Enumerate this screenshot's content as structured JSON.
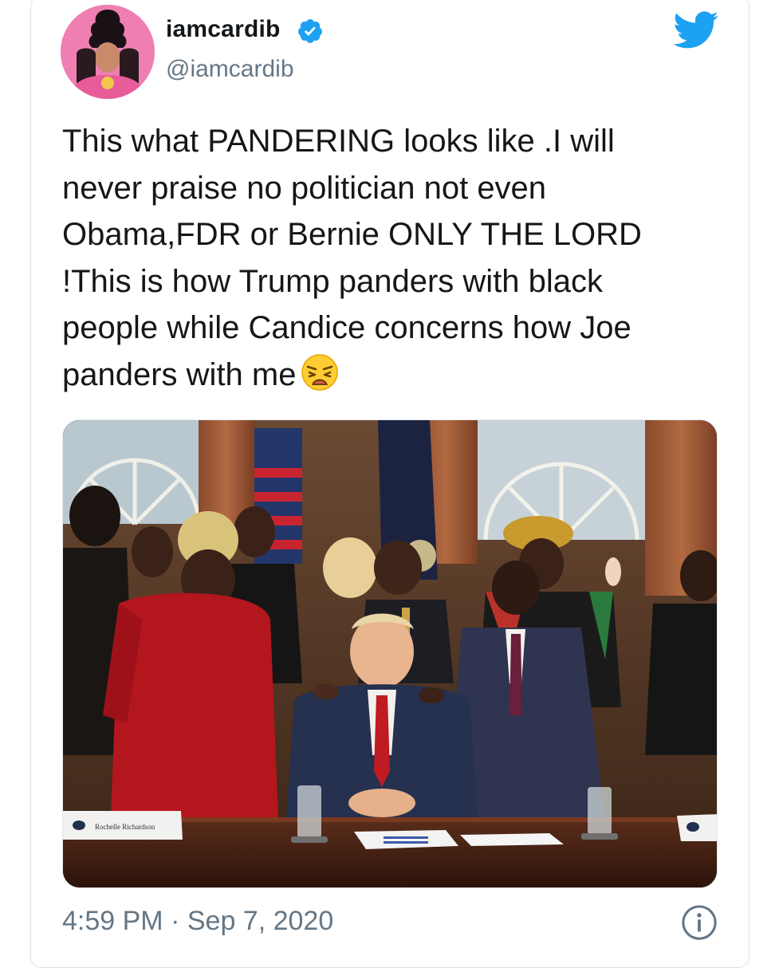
{
  "author": {
    "display_name": "iamcardib",
    "handle": "@iamcardib",
    "verified": true
  },
  "tweet": {
    "lines": [
      "This what PANDERING looks like .I will",
      "never praise no politician not even",
      "Obama,FDR or Bernie ONLY THE LORD",
      "!This is how Trump panders with black",
      "people while Candice concerns how Joe",
      "panders with me"
    ],
    "emoji": "weary-face-emoji"
  },
  "media": {
    "nameplate_text": "Rochelle Richardson"
  },
  "meta": {
    "time": "4:59 PM",
    "separator": "·",
    "date": "Sep 7, 2020"
  },
  "icons": {
    "verified": "verified-badge-icon",
    "brand": "twitter-bird-icon",
    "info": "info-icon"
  },
  "colors": {
    "twitter_blue": "#1da1f2",
    "secondary_text": "#657786",
    "primary_text": "#14171a"
  }
}
